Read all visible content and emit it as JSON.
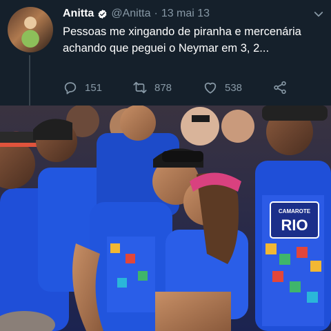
{
  "tweet": {
    "display_name": "Anitta",
    "handle": "@Anitta",
    "separator": "·",
    "date": "13 mai 13",
    "text": "Pessoas me xingando de piranha e mercenária achando que peguei o Neymar em 3, 2...",
    "reply_count": "151",
    "retweet_count": "878",
    "like_count": "538"
  },
  "photo": {
    "shirt_print": "RIO",
    "shirt_small": "CAMAROTE"
  },
  "icons": [
    "verified-icon",
    "chevron-down-icon",
    "reply-icon",
    "retweet-icon",
    "like-icon",
    "share-icon"
  ],
  "colors": {
    "background": "#15202b",
    "secondary_text": "#8899a6",
    "verified": "#ffffff",
    "shirt_blue": "#1f4fd8"
  }
}
